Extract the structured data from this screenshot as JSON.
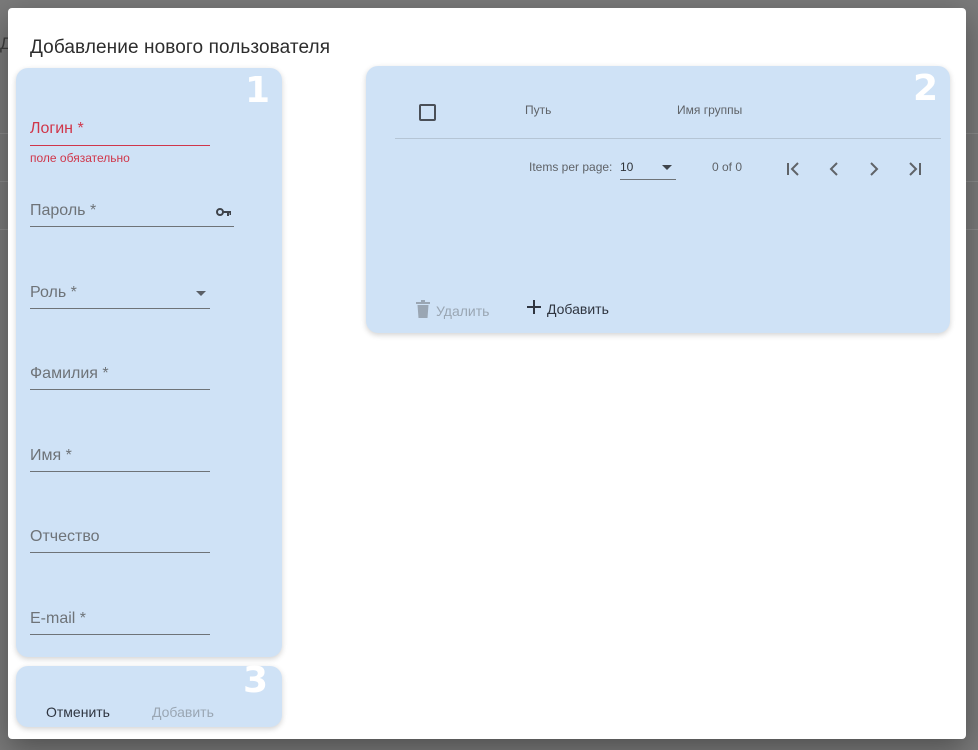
{
  "background": {
    "letter": "Д"
  },
  "dialog": {
    "title": "Добавление нового пользователя"
  },
  "form": {
    "number": "1",
    "login": {
      "label": "Логин *",
      "hint": "поле обязательно"
    },
    "password": {
      "label": "Пароль *",
      "icon": "key-icon"
    },
    "role": {
      "label": "Роль *"
    },
    "last_name": {
      "label": "Фамилия *"
    },
    "first_name": {
      "label": "Имя *"
    },
    "middle_name": {
      "label": "Отчество"
    },
    "email": {
      "label": "E-mail *"
    }
  },
  "groups": {
    "number": "2",
    "columns": [
      "Путь",
      "Имя группы"
    ],
    "paginator": {
      "items_per_page_label": "Items per page:",
      "page_size": "10",
      "range": "0 of 0"
    },
    "delete_label": "Удалить",
    "add_label": "Добавить"
  },
  "footer": {
    "number": "3",
    "cancel_label": "Отменить",
    "submit_label": "Добавить"
  },
  "colors": {
    "card": "#cfe2f6",
    "error": "#d0364a",
    "disabled": "#9aa6b3"
  }
}
